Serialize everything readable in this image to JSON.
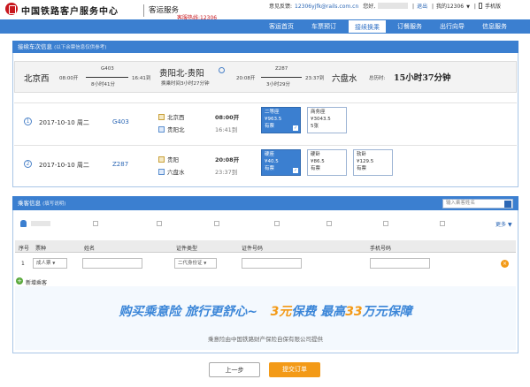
{
  "header": {
    "brand": "中国铁路客户服务中心",
    "sub_brand": "客运服务",
    "hotline": "客服热线:12306",
    "links": {
      "feedback": "意见反馈:",
      "email": "12306yjfk@rails.com.cn",
      "hello": "您好,",
      "user": "",
      "logout": "退出",
      "mine": "我的12306",
      "my_arrow": "▼",
      "mobile": "手机版"
    }
  },
  "nav": {
    "items": [
      "客运首页",
      "车票预订",
      "接续换乘",
      "订餐服务",
      "出行向导",
      "信息服务"
    ],
    "active": 2
  },
  "trip_panel": {
    "title": "接续车次信息",
    "hint": "(以下余票信息仅供参考)",
    "summary": {
      "from": "北京西",
      "dep_time": "08:00开",
      "train1": "G403",
      "dur1": "8小时41分",
      "arr1": "16:41到",
      "transfer": "贵阳北-贵阳",
      "transfer_note": "换乘时间3小时27分钟",
      "dep2": "20:08开",
      "train2": "Z287",
      "dur2": "3小时29分",
      "arr2": "23:37到",
      "to": "六盘水",
      "total_label": "总历时:",
      "total": "15小时37分钟"
    },
    "legs": [
      {
        "no": "1",
        "date": "2017-10-10 周二",
        "train": "G403",
        "from_stn": "北京西",
        "from_time": "08:00开",
        "to_stn": "贵阳北",
        "to_time": "16:41到",
        "seats": [
          {
            "name": "二等座",
            "price": "¥963.5",
            "avail": "有票",
            "selected": true
          },
          {
            "name": "商务座",
            "price": "¥3043.5",
            "avail": "5张",
            "selected": false
          }
        ]
      },
      {
        "no": "2",
        "date": "2017-10-10 周二",
        "train": "Z287",
        "from_stn": "贵阳",
        "from_time": "20:08开",
        "to_stn": "六盘水",
        "to_time": "23:37到",
        "seats": [
          {
            "name": "硬座",
            "price": "¥40.5",
            "avail": "有票",
            "selected": true
          },
          {
            "name": "硬卧",
            "price": "¥86.5",
            "avail": "有票",
            "selected": false
          },
          {
            "name": "软卧",
            "price": "¥129.5",
            "avail": "有票",
            "selected": false
          }
        ]
      }
    ]
  },
  "passenger_panel": {
    "title": "乘客信息",
    "hint": "(填写说明)",
    "search_placeholder": "输入乘客姓名",
    "more": "更多",
    "columns": [
      "序号",
      "票种",
      "姓名",
      "证件类型",
      "证件号码",
      "手机号码"
    ],
    "row": {
      "no": "1",
      "ticket_type": "成人票",
      "name": "",
      "id_type": "二代身份证",
      "id_no": "",
      "phone": ""
    },
    "add_label": "新增乘客"
  },
  "banner": {
    "slogan_a": "购买乘意险  旅行更舒心~",
    "price_a": "3元",
    "price_a_tail": "保费  最高",
    "price_b": "33",
    "price_b_tail": "万元保障",
    "note": "乘意险由中国铁路财产保险自保有限公司提供"
  },
  "buttons": {
    "prev": "上一步",
    "submit": "提交订单"
  },
  "colors": {
    "accent": "#3b7fd0",
    "brand_red": "#c8171e",
    "submit": "#f39a17"
  }
}
